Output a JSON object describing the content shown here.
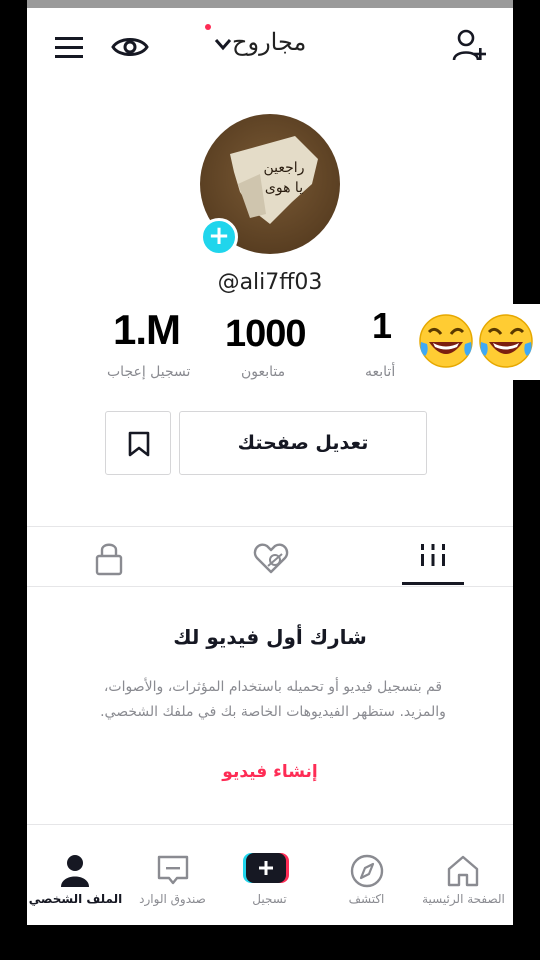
{
  "header": {
    "title": "مجاروح",
    "menu_icon": "hamburger-menu-icon",
    "eye_icon": "eye-icon",
    "add_user_icon": "add-user-icon"
  },
  "profile": {
    "handle": "@ali7ff03",
    "stats": {
      "likes_value": "1.M",
      "likes_label": "تسجيل إعجاب",
      "followers_value": "1000",
      "followers_label": "متابعون",
      "following_value": "1",
      "following_label": "أتابعه"
    },
    "edit_button": "تعديل صفحتك"
  },
  "empty_state": {
    "title": "شارك أول فيديو لك",
    "description": "قم بتسجيل فيديو أو تحميله باستخدام المؤثرات، والأصوات، والمزيد. ستظهر الفيديوهات الخاصة بك في ملفك الشخصي.",
    "create_link": "إنشاء فيديو"
  },
  "nav": {
    "home": "الصفحة الرئيسية",
    "discover": "اكتشف",
    "record": "تسجيل",
    "inbox": "صندوق الوارد",
    "profile": "الملف الشخصي"
  },
  "colors": {
    "accent": "#fe2c55",
    "cyan": "#20d5ec",
    "text": "#161823",
    "muted": "#8a8b91"
  }
}
